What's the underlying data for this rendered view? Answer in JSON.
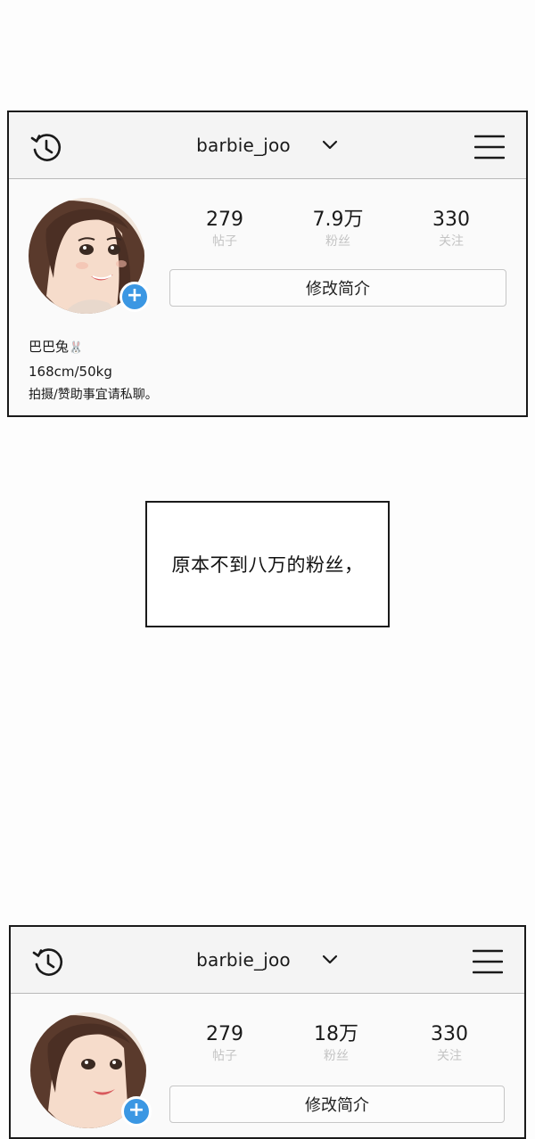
{
  "profiles": [
    {
      "username": "barbie_joo",
      "stats": [
        {
          "value": "279",
          "label": "帖子"
        },
        {
          "value": "7.9万",
          "label": "粉丝"
        },
        {
          "value": "330",
          "label": "关注"
        }
      ],
      "edit_button": "修改简介",
      "bio": {
        "name": "巴巴兔",
        "name_emoji": "🐰",
        "line2": "168cm/50kg",
        "line3": "拍摄/赞助事宜请私聊。"
      }
    },
    {
      "username": "barbie_joo",
      "stats": [
        {
          "value": "279",
          "label": "帖子"
        },
        {
          "value": "18万",
          "label": "粉丝"
        },
        {
          "value": "330",
          "label": "关注"
        }
      ],
      "edit_button": "修改简介"
    }
  ],
  "caption": "原本不到八万的粉丝，",
  "colors": {
    "add_badge": "#3b97e3",
    "panel_border": "#1a1a1a",
    "stat_label": "#c4c4c4"
  },
  "icons": [
    "history-icon",
    "chevron-down-icon",
    "menu-icon",
    "add-icon"
  ]
}
